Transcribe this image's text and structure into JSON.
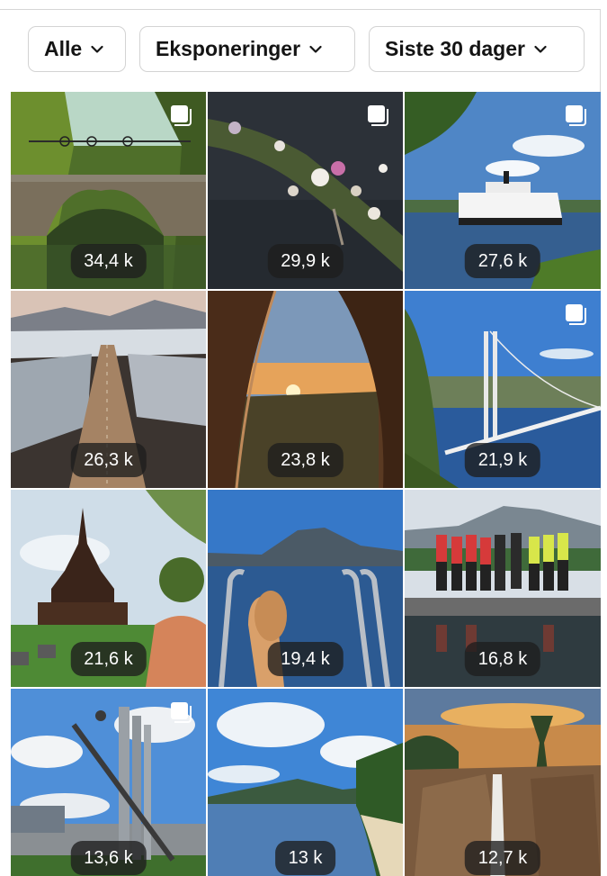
{
  "filters": {
    "all": "Alle",
    "metric": "Eksponeringer",
    "period": "Siste 30 dager"
  },
  "posts": [
    {
      "views": "34,4 k",
      "multi": true,
      "subject": "stone bridge with cyclists in green forest"
    },
    {
      "views": "29,9 k",
      "multi": true,
      "subject": "flowers floating on dark water"
    },
    {
      "views": "27,6 k",
      "multi": true,
      "subject": "white paddle steamer on lake"
    },
    {
      "views": "26,3 k",
      "multi": false,
      "subject": "aerial mountain road with snow"
    },
    {
      "views": "23,8 k",
      "multi": false,
      "subject": "sunset seen through tent opening"
    },
    {
      "views": "21,9 k",
      "multi": true,
      "subject": "suspension bridge over fjord"
    },
    {
      "views": "21,6 k",
      "multi": false,
      "subject": "wooden stave church"
    },
    {
      "views": "19,4 k",
      "multi": false,
      "subject": "woman on pool ladder facing mountain lake"
    },
    {
      "views": "16,8 k",
      "multi": false,
      "subject": "group of runners on dock by lake"
    },
    {
      "views": "13,6 k",
      "multi": true,
      "subject": "metal sculpture with town behind"
    },
    {
      "views": "13 k",
      "multi": false,
      "subject": "lake beach under blue sky"
    },
    {
      "views": "12,7 k",
      "multi": false,
      "subject": "waterfall over rocks at sunset"
    }
  ]
}
